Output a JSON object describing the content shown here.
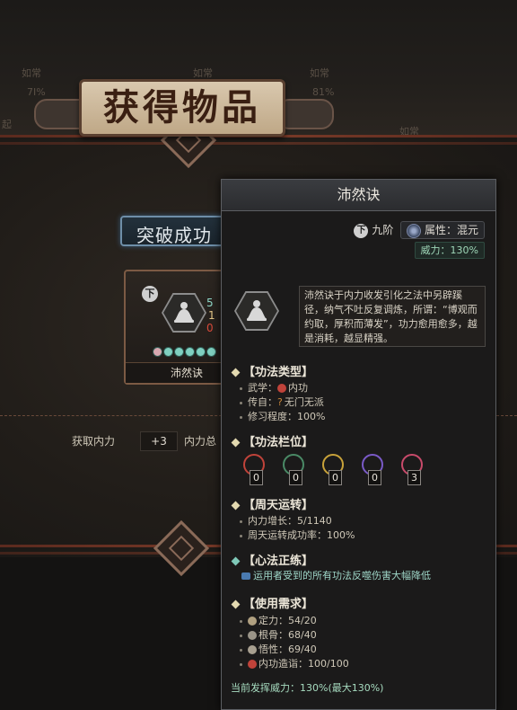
{
  "background": {
    "ghost_labels": [
      "如常",
      "7I%",
      "如常",
      "如常",
      "81%",
      "起",
      "加常",
      "如常"
    ],
    "banner_title": "获得物品",
    "success_label": "突破成功",
    "item_card": {
      "name": "沛然诀",
      "grade_badge": "下",
      "side_digits": [
        "5",
        "1",
        "0"
      ],
      "gem_count": 6
    },
    "stats": {
      "gain_label": "获取内力",
      "gain_value": "+3",
      "total_label": "内力总"
    }
  },
  "tooltip": {
    "title": "沛然诀",
    "grade_badge": "下",
    "grade_label": "九阶",
    "attribute_label": "属性：混元",
    "power_label": "威力：130%",
    "description": "沛然诀于内力收发引化之法中另辟蹊径，纳气不吐反复调炼，所谓：“博观而约取，厚积而薄发”，功力愈用愈多，越是消耗，越显精强。",
    "sections": {
      "type_title": "【功法类型】",
      "type_rows": {
        "wuxue": "武学：",
        "wuxue_value": "内功",
        "chuanzi": "传自：",
        "chuanzi_value": "无门无派",
        "progress": "修习程度：",
        "progress_value": "100%"
      },
      "slots_title": "【功法栏位】",
      "slots": [
        {
          "value": "0",
          "color": "#c0433a"
        },
        {
          "value": "0",
          "color": "#4a8a66"
        },
        {
          "value": "0",
          "color": "#c8a23a"
        },
        {
          "value": "0",
          "color": "#7a5ac8"
        },
        {
          "value": "3",
          "color": "#c84a6a"
        }
      ],
      "cycle_title": "【周天运转】",
      "cycle_rows": {
        "growth": "内力增长：",
        "growth_value": "5/1140",
        "rate": "周天运转成功率：",
        "rate_value": "100%"
      },
      "heart_title": "【心法正练】",
      "heart_effect": "运用者受到的所有功法反噬伤害大幅降低",
      "req_title": "【使用需求】",
      "req_rows": {
        "dingli": "定力：",
        "dingli_value": "54/20",
        "gengu": "根骨：",
        "gengu_value": "68/40",
        "wuxing": "悟性：",
        "wuxing_value": "69/40",
        "neigong": "内功造诣：",
        "neigong_value": "100/100"
      },
      "footer": "当前发挥威力：130%(最大130%)"
    }
  },
  "colors": {
    "accent_green": "#a7dcc0",
    "rail_red": "#7a3a28"
  }
}
